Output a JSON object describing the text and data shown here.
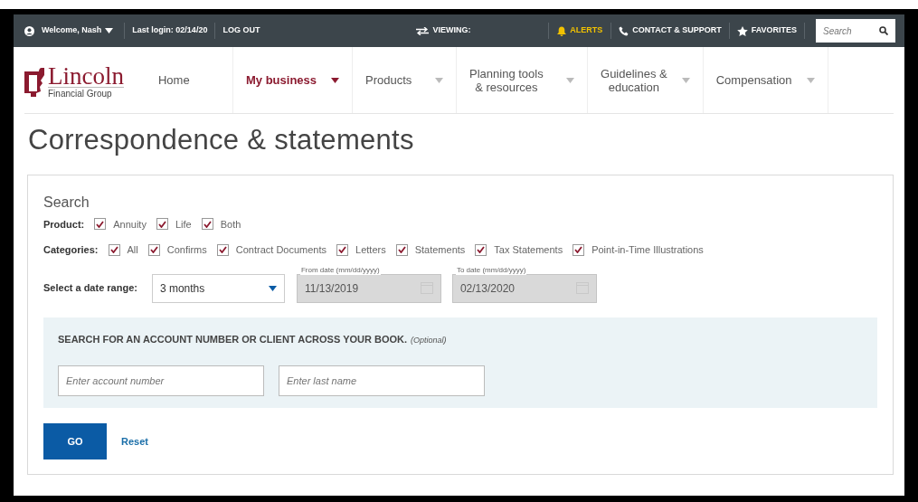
{
  "top_bar": {
    "user_menu": "Welcome, Nash",
    "last_login": "Last login: 02/14/20",
    "logout": "LOG OUT",
    "viewing": "VIEWING:",
    "alerts": "ALERTS",
    "contact": "CONTACT & SUPPORT",
    "favorites": "FAVORITES",
    "search": {
      "placeholder": "Search"
    }
  },
  "logo": {
    "name": "Lincoln",
    "subtitle": "Financial Group"
  },
  "nav": [
    {
      "label": "Home",
      "selected": false,
      "dropdown": false
    },
    {
      "label": "My business",
      "selected": true,
      "dropdown": true
    },
    {
      "label": "Products",
      "selected": false,
      "dropdown": true
    },
    {
      "label": "Planning tools\n& resources",
      "selected": false,
      "dropdown": true
    },
    {
      "label": "Guidelines &\neducation",
      "selected": false,
      "dropdown": true
    },
    {
      "label": "Compensation",
      "selected": false,
      "dropdown": true
    }
  ],
  "page_title": "Correspondence & statements",
  "search": {
    "heading": "Search",
    "filters": [
      {
        "label": "Product:",
        "options": [
          {
            "label": "Annuity",
            "checked": true
          },
          {
            "label": "Life",
            "checked": true
          },
          {
            "label": "Both",
            "checked": true
          }
        ]
      },
      {
        "label": "Categories:",
        "options": [
          {
            "label": "All",
            "checked": true
          },
          {
            "label": "Confirms",
            "checked": true
          },
          {
            "label": "Contract Documents",
            "checked": true
          },
          {
            "label": "Letters",
            "checked": true
          },
          {
            "label": "Statements",
            "checked": true
          },
          {
            "label": "Tax Statements",
            "checked": true
          },
          {
            "label": "Point-in-Time Illustrations",
            "checked": true
          }
        ]
      }
    ],
    "date_range": {
      "label": "Select a date range:",
      "value": "3 months",
      "from": {
        "label": "From date (mm/dd/yyyy)",
        "value": "11/13/2019",
        "disabled": true
      },
      "to": {
        "label": "To date (mm/dd/yyyy)",
        "value": "02/13/2020",
        "disabled": true
      }
    },
    "account_search": {
      "heading": "SEARCH FOR AN ACCOUNT NUMBER OR CLIENT ACROSS YOUR BOOK.",
      "note": "(Optional)",
      "fields": [
        {
          "placeholder": "Enter account number"
        },
        {
          "placeholder": "Enter last name"
        }
      ]
    },
    "go_button": "GO",
    "reset_link": "Reset"
  }
}
